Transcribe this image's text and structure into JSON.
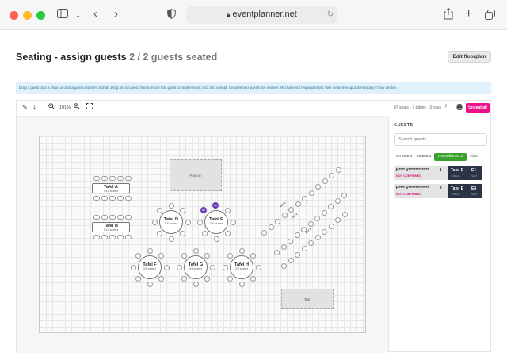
{
  "browser": {
    "url": "eventplanner.net"
  },
  "page": {
    "title": "Seating - assign guests",
    "seated_summary": "2 / 2 guests seated",
    "edit_floorplan_label": "Edit floorplan",
    "info_banner": "Drag a guest onto a chair, or click a guest and then a chair. Drag an occupied chair to move that guest to another seat; click it to unseat. Unconfirmed guests are invitees who have not responded yet; their seats free up automatically if they decline."
  },
  "toolbar": {
    "zoom_level": "101%",
    "stats": "87 seats · 7 tables · 3 rows",
    "print_icon": "printer-icon",
    "unseat_all_label": "Unseat all"
  },
  "floorplan": {
    "zones": [
      {
        "name": "Podium"
      },
      {
        "name": "Bar"
      }
    ],
    "rect_tables": [
      {
        "name": "Tafel A",
        "status": "0/10 seated"
      },
      {
        "name": "Tafel B",
        "status": "0/10 seated"
      }
    ],
    "round_tables": [
      {
        "name": "Tafel D",
        "status": "0/8 seated"
      },
      {
        "name": "Tafel E",
        "status": "2/8 seated"
      },
      {
        "name": "Tafel F",
        "status": "0/8 seated"
      },
      {
        "name": "Tafel G",
        "status": "0/8 seated"
      },
      {
        "name": "Tafel H",
        "status": "0/8 seated"
      }
    ],
    "seated_guest_initials": [
      "KV",
      "KV"
    ],
    "row_labels": [
      "RIJ 3",
      "RIJ 2",
      "RIJ 1"
    ]
  },
  "sidebar": {
    "heading": "GUESTS",
    "search_placeholder": "Search guests...",
    "filters": [
      {
        "label": "No seat 0",
        "active": false
      },
      {
        "label": "Seated 2",
        "active": false
      },
      {
        "label": "Unconfirmed 2",
        "active": true
      },
      {
        "label": "All 2",
        "active": false
      }
    ],
    "guests": [
      {
        "name": "K**** V**************",
        "number": "1",
        "status": "NOT CONFIRMED",
        "table": "Tafel E",
        "table_label": "TABLE",
        "seat": "E1",
        "seat_label": "SEAT"
      },
      {
        "name": "K**** V**************",
        "number": "2",
        "status": "NOT CONFIRMED",
        "table": "Tafel E",
        "table_label": "TABLE",
        "seat": "E8",
        "seat_label": "SEAT"
      }
    ]
  },
  "colors": {
    "accent_pink": "#ec0f8a",
    "filter_active": "#3aa12f",
    "guest_seat": "#6a3fb5",
    "seat_card": "#2b3444"
  }
}
